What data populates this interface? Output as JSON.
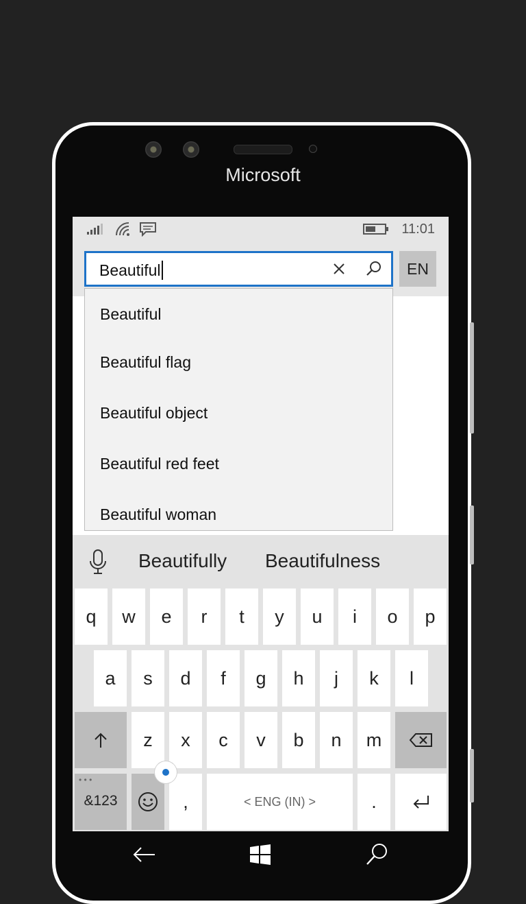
{
  "device": {
    "brand": "Microsoft"
  },
  "status": {
    "time": "11:01",
    "icons": [
      "signal-icon",
      "wifi-icon",
      "message-icon",
      "battery-icon"
    ]
  },
  "search": {
    "value": "Beautiful",
    "lang_label": "EN"
  },
  "suggestions": [
    "Beautiful",
    "Beautiful flag",
    "Beautiful object",
    "Beautiful red feet",
    "Beautiful woman"
  ],
  "predictions": [
    "Beautifully",
    "Beautifulness"
  ],
  "keyboard": {
    "row1": [
      "q",
      "w",
      "e",
      "r",
      "t",
      "y",
      "u",
      "i",
      "o",
      "p"
    ],
    "row2": [
      "a",
      "s",
      "d",
      "f",
      "g",
      "h",
      "j",
      "k",
      "l"
    ],
    "row3": [
      "z",
      "x",
      "c",
      "v",
      "b",
      "n",
      "m"
    ],
    "symbols_label": "&123",
    "comma_label": ",",
    "space_label": "< ENG (IN) >",
    "period_label": "."
  },
  "colors": {
    "accent": "#1e73c8",
    "screen_bg": "#ffffff",
    "panel_bg": "#e6e6e6",
    "dark_key": "#bcbcbc"
  }
}
